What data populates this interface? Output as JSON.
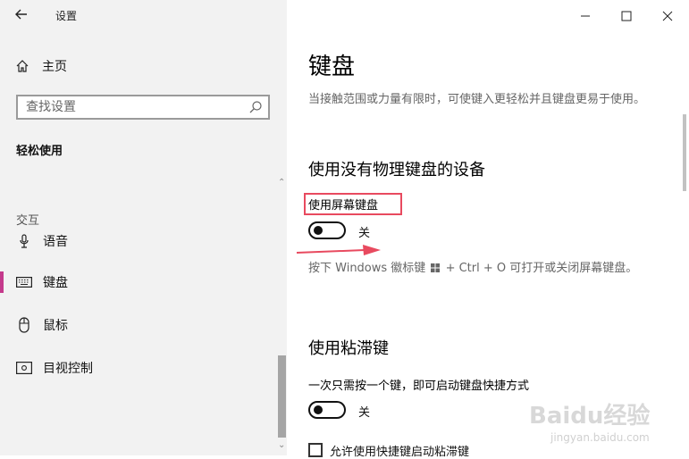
{
  "left": {
    "back_icon": "back-arrow-icon",
    "app_title": "设置",
    "home_label": "主页",
    "search_placeholder": "查找设置",
    "category": "轻松使用",
    "section_label": "交互",
    "nav_items": [
      {
        "label": "语音",
        "icon": "microphone-icon"
      },
      {
        "label": "键盘",
        "icon": "keyboard-icon",
        "active": true
      },
      {
        "label": "鼠标",
        "icon": "mouse-icon"
      },
      {
        "label": "目视控制",
        "icon": "eye-control-icon"
      }
    ]
  },
  "right": {
    "title": "键盘",
    "description": "当接触范围或力量有限时，可使键入更轻松并且键盘更易于使用。",
    "section1_title": "使用没有物理键盘的设备",
    "onscreen_keyboard_label": "使用屏幕键盘",
    "onscreen_keyboard_state": "关",
    "hint_prefix": "按下 Windows 徽标键",
    "hint_suffix": "+ Ctrl + O 可打开或关闭屏幕键盘。",
    "section2_title": "使用粘滞键",
    "sticky_desc": "一次只需按一个键，即可启动键盘快捷方式",
    "sticky_state": "关",
    "shortcut_checkbox_label": "允许使用快捷键启动粘滞键"
  },
  "watermark": {
    "text": "Baidu经验",
    "url": "jingyan.baidu.com"
  },
  "colors": {
    "highlight_box": "#e84a5f",
    "arrow": "#e84a5f",
    "active_indicator": "#c43a8c",
    "left_pane_bg": "#f2f2f2"
  }
}
